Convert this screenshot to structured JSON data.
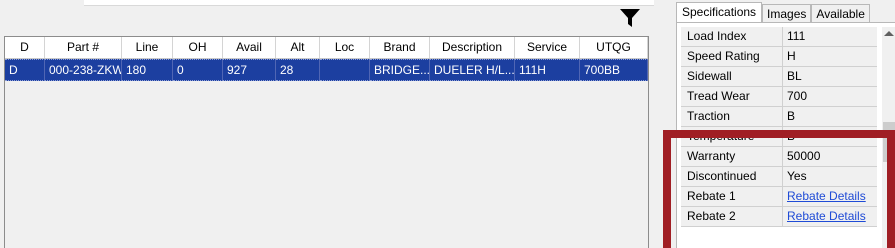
{
  "results_grid": {
    "columns": [
      "D",
      "Part #",
      "Line",
      "OH",
      "Avail",
      "Alt",
      "Loc",
      "Brand",
      "Description",
      "Service",
      "UTQG"
    ],
    "rows": [
      {
        "d": "D",
        "part": "000-238-ZKW",
        "line": "180",
        "oh": "0",
        "avail": "927",
        "alt": "28",
        "loc": "",
        "brand": "BRIDGE...",
        "description": "DUELER H/L...",
        "service": "111H",
        "utqg": "700BB"
      }
    ]
  },
  "tabs": [
    "Specifications",
    "Images",
    "Available"
  ],
  "specs": [
    {
      "key": "Load Index",
      "value": "111"
    },
    {
      "key": "Speed Rating",
      "value": "H"
    },
    {
      "key": "Sidewall",
      "value": "BL"
    },
    {
      "key": "Tread Wear",
      "value": "700"
    },
    {
      "key": "Traction",
      "value": "B"
    },
    {
      "key": "Temperature",
      "value": "B"
    },
    {
      "key": "Warranty",
      "value": "50000"
    },
    {
      "key": "Discontinued",
      "value": "Yes"
    },
    {
      "key": "Rebate 1",
      "value": "Rebate Details"
    },
    {
      "key": "Rebate 2",
      "value": "Rebate Details"
    }
  ],
  "colors": {
    "selection": "#1c3fa0",
    "highlight": "#a01e24",
    "link": "#1f4bd6"
  },
  "icons": {
    "filter": "funnel-filter-icon"
  }
}
